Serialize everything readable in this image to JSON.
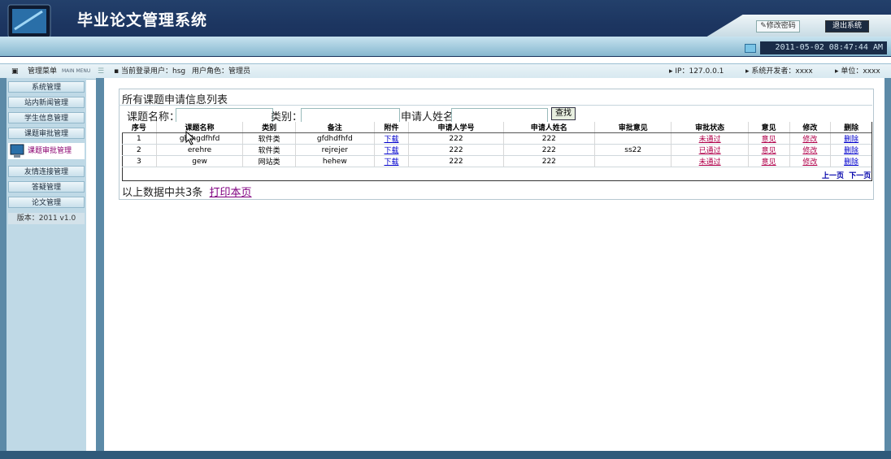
{
  "app": {
    "title": "毕业论文管理系统",
    "change_password": "修改密码",
    "logout": "退出系统",
    "datetime": "2011-05-02 08:47:44 AM"
  },
  "status": {
    "menu_label": "管理菜单",
    "menu_en": "MAIN MENU",
    "login_user": "当前登录用户：hsg",
    "role": "用户角色：管理员",
    "ip": "IP：127.0.0.1",
    "developer": "系统开发者：xxxx",
    "unit": "单位：xxxx"
  },
  "sidebar": {
    "items": [
      {
        "label": "系统管理"
      },
      {
        "label": "站内新闻管理"
      },
      {
        "label": "学生信息管理"
      },
      {
        "label": "课题审批管理"
      },
      {
        "label": "课题审批管理"
      },
      {
        "label": "友情连接管理"
      },
      {
        "label": "答疑管理"
      },
      {
        "label": "论文管理"
      }
    ],
    "version": "版本：2011 v1.0"
  },
  "panel": {
    "title": "所有课题申请信息列表"
  },
  "search": {
    "topic_label": "课题名称：",
    "category_label": "类别：",
    "applicant_label": "申请人姓名",
    "button": "查找"
  },
  "table": {
    "headers": [
      "序号",
      "课题名称",
      "类别",
      "备注",
      "附件",
      "申请人学号",
      "申请人姓名",
      "审批意见",
      "审批状态",
      "意见",
      "修改",
      "删除"
    ],
    "rows": [
      {
        "no": "1",
        "name": "ghfhgdfhfd",
        "category": "软件类",
        "note": "gfdhdfhfd",
        "attach": "下载",
        "sid": "222",
        "sname": "222",
        "opinion": "",
        "status": "未通过",
        "op": "意见",
        "edit": "修改",
        "del": "删除"
      },
      {
        "no": "2",
        "name": "erehre",
        "category": "软件类",
        "note": "rejrejer",
        "attach": "下载",
        "sid": "222",
        "sname": "222",
        "opinion": "ss22",
        "status": "已通过",
        "op": "意见",
        "edit": "修改",
        "del": "删除"
      },
      {
        "no": "3",
        "name": "gew",
        "category": "网站类",
        "note": "hehew",
        "attach": "下载",
        "sid": "222",
        "sname": "222",
        "opinion": "",
        "status": "未通过",
        "op": "意见",
        "edit": "修改",
        "del": "删除"
      }
    ],
    "pager_prev": "上一页",
    "pager_next": "下一页"
  },
  "footer": {
    "summary": "以上数据中共3条",
    "print": "打印本页"
  }
}
